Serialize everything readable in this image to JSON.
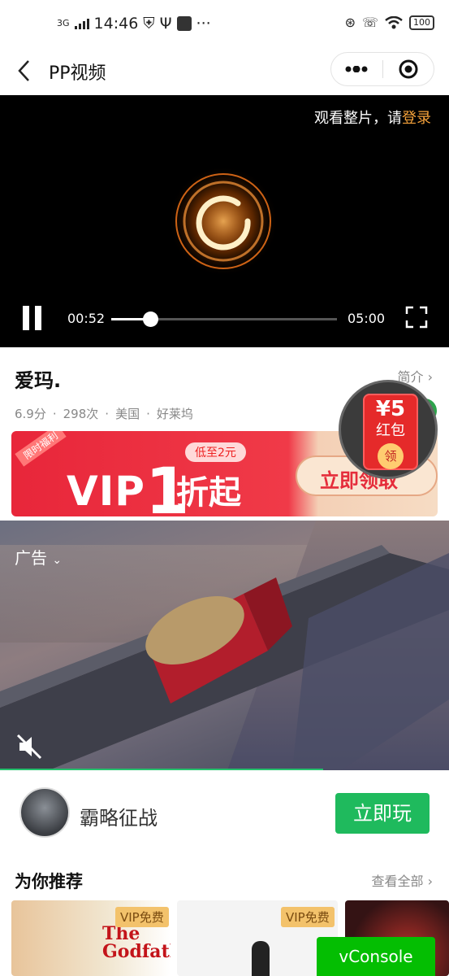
{
  "status_bar": {
    "network": "3G",
    "time": "14:46",
    "extra": "···",
    "battery": "100"
  },
  "nav": {
    "title": "PP视频"
  },
  "player": {
    "login_tip_prefix": "观看整片，请",
    "login_link": "登录",
    "current_time": "00:52",
    "duration": "05:00",
    "progress_fraction": 0.173
  },
  "video_info": {
    "title": "爱玛.",
    "intro_label": "简介",
    "rating": "6.9分",
    "plays": "298次",
    "region": "美国",
    "genre": "好莱坞"
  },
  "vip_banner": {
    "tag": "限时福利",
    "text_vip": "VIP",
    "text_one": "1",
    "text_zhe": "折起",
    "low_price": "低至2元",
    "button": "立即领取"
  },
  "red_packet": {
    "amount": "¥5",
    "label": "红包",
    "coin": "领"
  },
  "ad": {
    "label": "广告",
    "game_name": "霸略征战",
    "play_button": "立即玩",
    "progress_fraction": 0.72
  },
  "recommend": {
    "heading": "为你推荐",
    "view_all": "查看全部",
    "items": [
      {
        "badge": "VIP免费",
        "poster_text": "The Godfather"
      },
      {
        "badge": "VIP免费"
      },
      {}
    ]
  },
  "vconsole": "vConsole"
}
